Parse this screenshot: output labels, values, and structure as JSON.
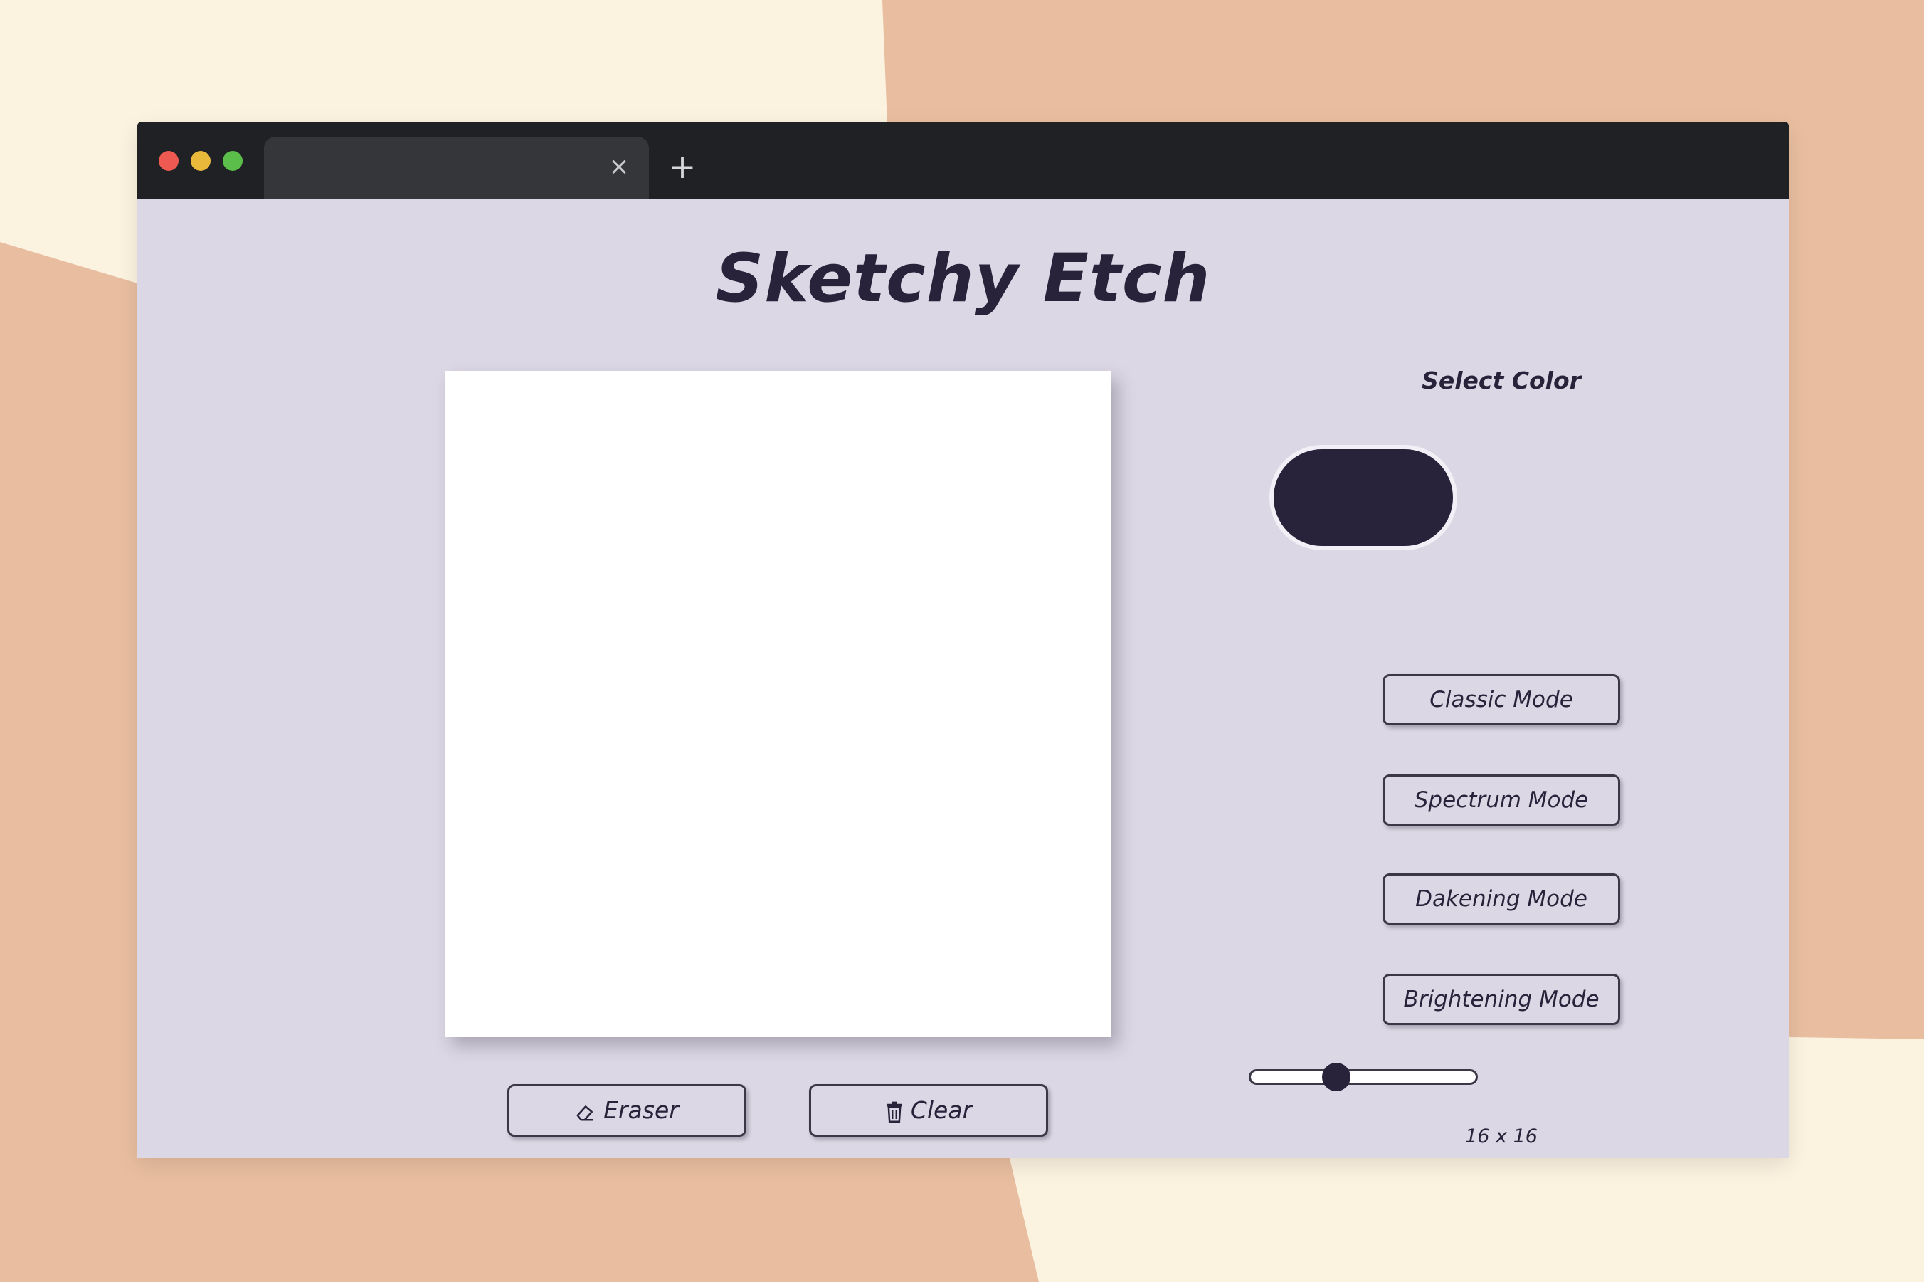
{
  "colors": {
    "background_cream": "#fbf2df",
    "background_peach": "#e9bea0",
    "titlebar": "#202124",
    "tab": "#35363a",
    "page": "#dcd7e4",
    "ink": "#28233a",
    "dot_red": "#ee5a52",
    "dot_yellow": "#e8b93a",
    "dot_green": "#5bbd4a"
  },
  "browser": {
    "tab_title": "",
    "tab_close_glyph": "×",
    "new_tab_glyph": "+"
  },
  "app": {
    "title": "Sketchy Etch",
    "select_color_label": "Select Color",
    "selected_color": "#28233a",
    "modes": [
      {
        "label": "Classic Mode"
      },
      {
        "label": "Spectrum Mode"
      },
      {
        "label": "Dakening Mode"
      },
      {
        "label": "Brightening Mode"
      }
    ],
    "grid_size": {
      "label": "16 x 16",
      "value": 16,
      "min": 1,
      "max": 100
    },
    "eraser": {
      "label": "Eraser",
      "icon": "eraser-icon"
    },
    "clear": {
      "label": "Clear",
      "icon": "trash-icon"
    }
  }
}
